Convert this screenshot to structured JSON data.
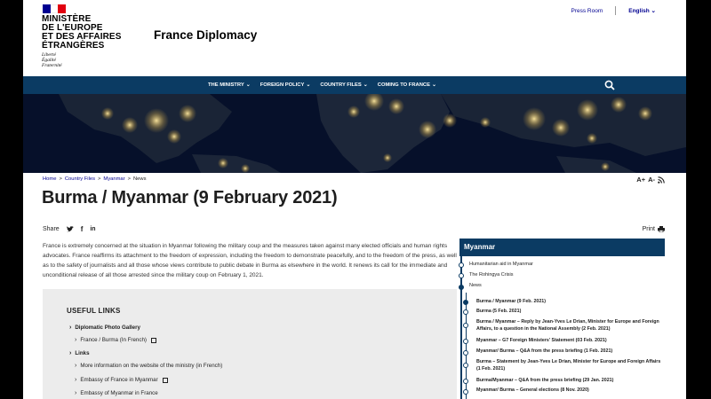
{
  "header": {
    "ministry_lines": [
      "MINISTÈRE",
      "DE L'EUROPE",
      "ET DES AFFAIRES",
      "ÉTRANGÈRES"
    ],
    "motto_lines": [
      "Liberté",
      "Égalité",
      "Fraternité"
    ],
    "site_title": "France Diplomacy",
    "press_room": "Press Room",
    "language": "English",
    "colors": {
      "flag_blue": "#000091",
      "flag_white": "#ffffff",
      "flag_red": "#e1000f"
    }
  },
  "nav": {
    "items": [
      {
        "label": "THE MINISTRY",
        "icon": "chevron-down-icon"
      },
      {
        "label": "FOREIGN POLICY",
        "icon": "chevron-down-icon"
      },
      {
        "label": "COUNTRY FILES",
        "icon": "chevron-down-icon"
      },
      {
        "label": "COMING TO FRANCE",
        "icon": "chevron-down-icon"
      }
    ],
    "search_icon": "search-icon",
    "color": "#0b3b63"
  },
  "breadcrumb": {
    "items": [
      "Home",
      "Country Files",
      "Myanmar"
    ],
    "current": "News",
    "separator": ">"
  },
  "tools": {
    "font_increase": "A+",
    "font_decrease": "A-",
    "rss_icon": "rss-icon"
  },
  "article": {
    "title": "Burma / Myanmar (9 February 2021)",
    "share_label": "Share",
    "share_icons": [
      "twitter-icon",
      "facebook-icon",
      "linkedin-icon"
    ],
    "print_label": "Print",
    "lead": "France is extremely concerned at the situation in Myanmar following the military coup and the measures taken against many elected officials and human rights advocates. France reaffirms its attachment to the freedom of expression, including the freedom to demonstrate peacefully, and to the freedom of the press, as well as to the safety of journalists and all those whose views contribute to public debate in Burma as elsewhere in the world. It renews its call for the immediate and unconditional release of all those arrested since the military coup on February 1, 2021."
  },
  "useful_links": {
    "heading": "USEFUL LINKS",
    "groups": [
      {
        "label": "Diplomatic Photo Gallery",
        "children": [
          "France / Burma (In French)"
        ]
      },
      {
        "label": "Links",
        "children": [
          "More information on the website of the ministry (in French)",
          "Embassy of France in Myanmar",
          "Embassy of Myanmar in France"
        ]
      }
    ]
  },
  "sidebar": {
    "heading": "Myanmar",
    "items": [
      "Humanitarian aid in Myanmar",
      "The Rohingya Crisis",
      "News"
    ],
    "news": [
      "Burma / Myanmar (9 Feb. 2021)",
      "Burma (5 Feb. 2021)",
      "Burma / Myanmar – Reply by Jean-Yves Le Drian, Minister for Europe and Foreign Affairs, to a question in the National Assembly (2 Feb. 2021)",
      "Myanmar – G7 Foreign Ministers' Statement (03 Feb. 2021)",
      "Myanmar/ Burma – Q&A from the press briefing (1 Feb. 2021)",
      "Burma – Statement by Jean-Yves Le Drian, Minister for Europe and Foreign Affairs (1 Feb. 2021)",
      "Burma/Myanmar – Q&A from the press briefing (29 Jan. 2021)",
      "Myanmar/ Burma – General elections (8 Nov. 2020)"
    ]
  }
}
